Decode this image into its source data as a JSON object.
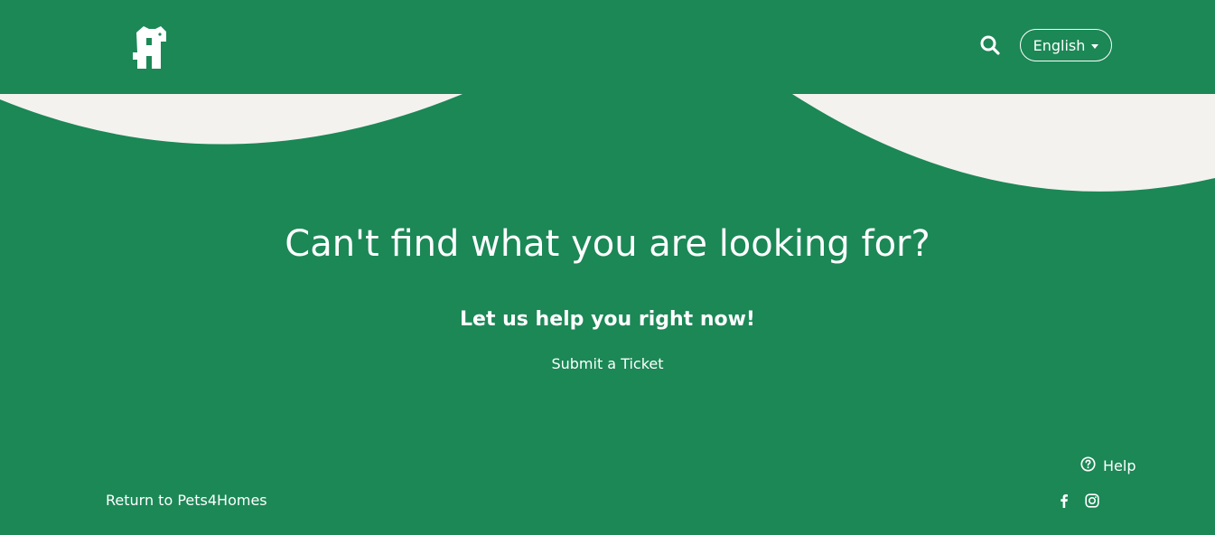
{
  "header": {
    "logo_icon": "pets4homes-logo-icon",
    "search_icon": "search-icon",
    "language": {
      "selected": "English",
      "icon": "chevron-down-icon"
    }
  },
  "main": {
    "headline": "Can't find what you are looking for?",
    "subheadline": "Let us help you right now!",
    "ticket_link": "Submit a Ticket"
  },
  "footer": {
    "help_label": "Help",
    "help_icon": "question-circle-icon",
    "return_link": "Return to Pets4Homes",
    "social": [
      "facebook-icon",
      "instagram-icon"
    ]
  },
  "colors": {
    "background": "#1b8856",
    "wave": "#f4f2ee",
    "text": "#ffffff"
  }
}
